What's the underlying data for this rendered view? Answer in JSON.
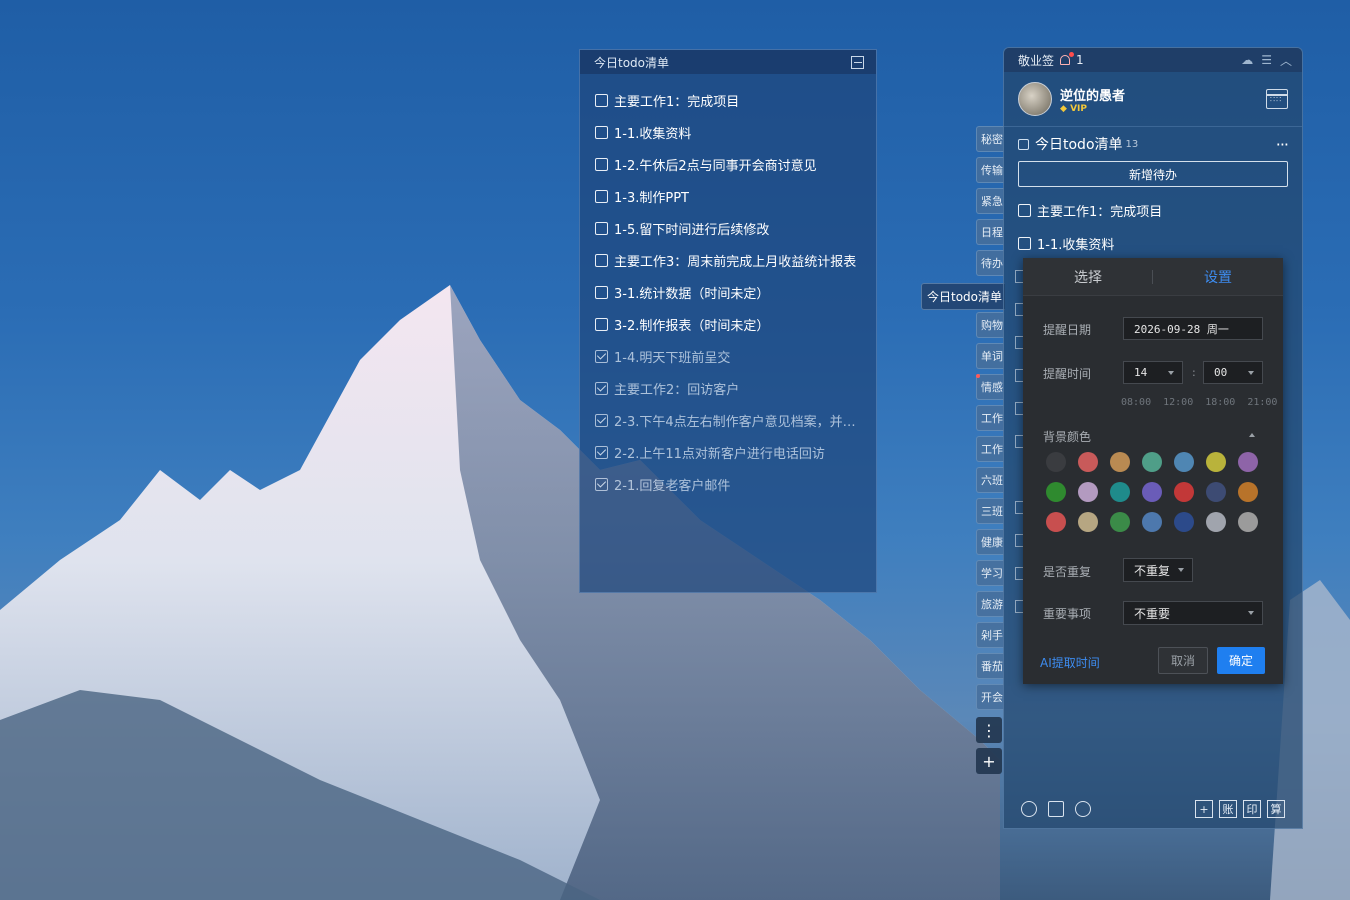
{
  "note": {
    "title": "今日todo清单",
    "items": [
      {
        "text": "主要工作1：完成项目",
        "done": false
      },
      {
        "text": "1-1.收集资料",
        "done": false
      },
      {
        "text": "1-2.午休后2点与同事开会商讨意见",
        "done": false
      },
      {
        "text": "1-3.制作PPT",
        "done": false
      },
      {
        "text": "1-5.留下时间进行后续修改",
        "done": false
      },
      {
        "text": "主要工作3：周末前完成上月收益统计报表",
        "done": false
      },
      {
        "text": "3-1.统计数据（时间未定）",
        "done": false
      },
      {
        "text": "3-2.制作报表（时间未定）",
        "done": false
      },
      {
        "text": "1-4.明天下班前呈交",
        "done": true
      },
      {
        "text": "主要工作2：回访客户",
        "done": true
      },
      {
        "text": "2-3.下午4点左右制作客户意见档案，并交...",
        "done": true
      },
      {
        "text": "2-2.上午11点对新客户进行电话回访",
        "done": true
      },
      {
        "text": "2-1.回复老客户邮件",
        "done": true
      }
    ]
  },
  "side_tabs": [
    "秘密",
    "传输",
    "紧急",
    "日程",
    "待办",
    "今日todo清单",
    "购物",
    "单词",
    "情感",
    "工作",
    "工作",
    "六班",
    "三班",
    "健康",
    "学习",
    "旅游",
    "剁手",
    "番茄",
    "开会"
  ],
  "active_tab": "今日todo清单",
  "side_buttons": {
    "more": "⋮",
    "add": "+"
  },
  "panel": {
    "app_name": "敬业签",
    "notification_count": "1",
    "user_name": "逆位的愚者",
    "vip_label": "VIP",
    "list_title": "今日todo清单",
    "list_count": "13",
    "more": "···",
    "add_button": "新增待办",
    "items": [
      "主要工作1：完成项目",
      "1-1.收集资料"
    ],
    "bottom_boxes": [
      "+",
      "账",
      "印",
      "算"
    ]
  },
  "popup": {
    "tabs": [
      "选择",
      "设置"
    ],
    "active_tab": "设置",
    "date_label": "提醒日期",
    "date_value": "2026-09-28 周一",
    "time_label": "提醒时间",
    "hour": "14",
    "minute": "00",
    "colon": ":",
    "quick_times": [
      "08:00",
      "12:00",
      "18:00",
      "21:00"
    ],
    "color_label": "背景颜色",
    "colors": [
      "#3a3c40",
      "#c85a5a",
      "#b98a52",
      "#4f9e88",
      "#4f86b3",
      "#b9b33b",
      "#8e64a8",
      "#2f8a2f",
      "#b39ac0",
      "#1f8b8b",
      "#6a5cb8",
      "#c23838",
      "#3d4b73",
      "#b8732a",
      "#c84f4f",
      "#b6a682",
      "#3b8b48",
      "#4d78ad",
      "#2c4a8a",
      "#a0a4ad",
      "#9b9b9b"
    ],
    "repeat_label": "是否重复",
    "repeat_value": "不重复",
    "important_label": "重要事项",
    "important_value": "不重要",
    "ai_link": "AI提取时间",
    "cancel": "取消",
    "confirm": "确定"
  }
}
